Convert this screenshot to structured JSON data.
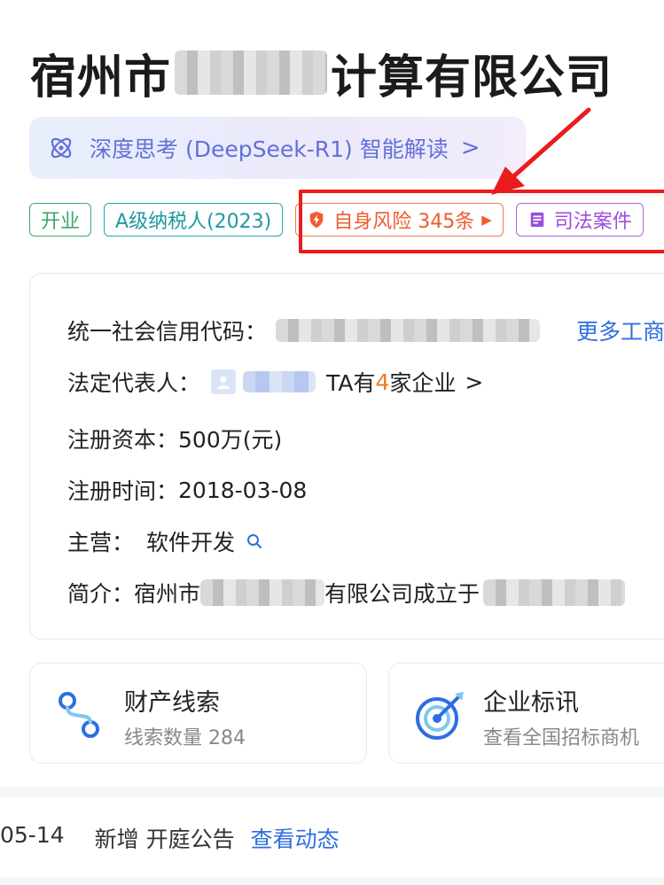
{
  "company": {
    "name_prefix": "宿州市",
    "name_suffix": "计算有限公司"
  },
  "ai_banner": {
    "label": "深度思考 (DeepSeek-R1) 智能解读",
    "chevron": ">"
  },
  "tags": {
    "status": "开业",
    "taxpayer": "A级纳税人(2023)",
    "risk": "自身风险 345条",
    "court": "司法案件"
  },
  "info": {
    "credit_code_label": "统一社会信用代码：",
    "more_link": "更多工商",
    "legal_rep_label": "法定代表人：",
    "legal_rep_ta": "TA有",
    "legal_rep_count": "4",
    "legal_rep_suffix": "家企业",
    "legal_rep_chevron": ">",
    "capital_label": "注册资本：",
    "capital_value": "500万(元)",
    "reg_date_label": "注册时间：",
    "reg_date_value": "2018-03-08",
    "business_label": "主营：",
    "business_value": "软件开发",
    "brief_label": "简介：宿州市",
    "brief_mid": "有限公司成立于"
  },
  "cards": {
    "asset_title": "财产线索",
    "asset_sub": "线索数量 284",
    "bid_title": "企业标讯",
    "bid_sub": "查看全国招标商机"
  },
  "news": {
    "date": "05-14",
    "text": "新增 开庭公告",
    "link": "查看动态"
  },
  "colors": {
    "accent_blue": "#2f6ee0",
    "risk_orange": "#ef5c2f",
    "annotation_red": "#ea1c1c"
  }
}
